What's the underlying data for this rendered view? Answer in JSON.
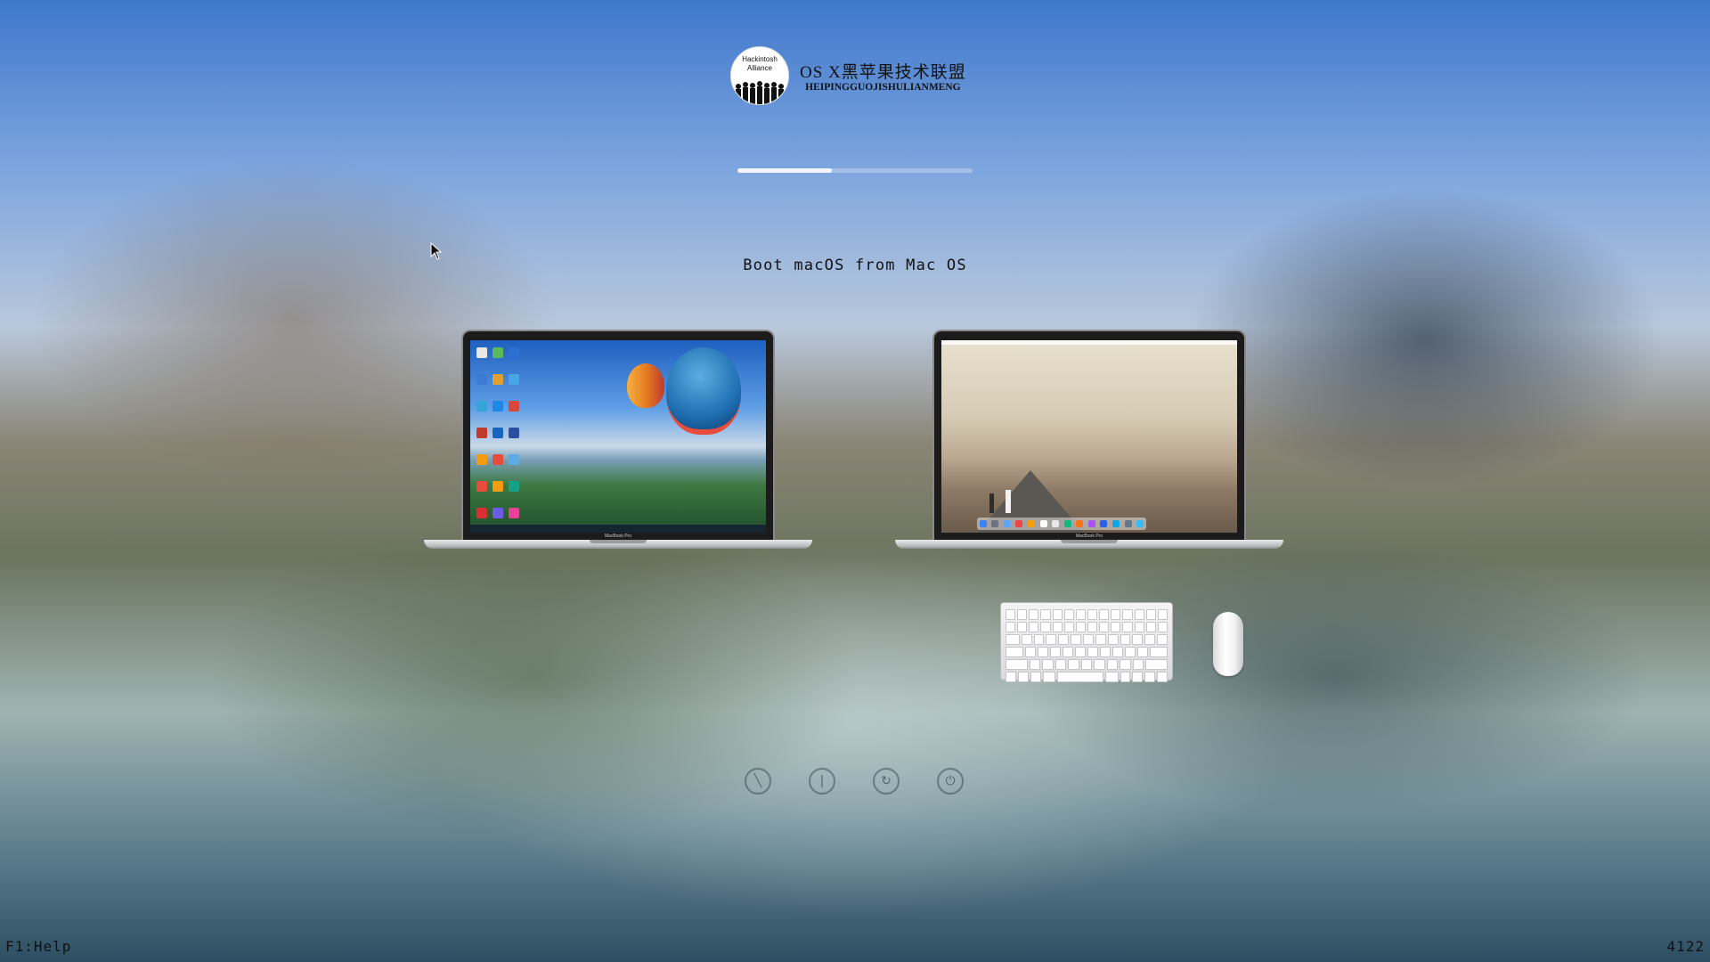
{
  "logo": {
    "badge_text": "Hackintosh Alliance",
    "title": "OS X黑苹果技术联盟",
    "subtitle": "HEIPINGGUOJISHULIANMENG"
  },
  "boot_progress": 0.4,
  "selected_entry_title": "Boot macOS from Mac OS",
  "boot_entries": [
    {
      "name": "windows-volume",
      "icon": "laptop-windows-desktop-icon",
      "laptop_label": "MacBook Pro"
    },
    {
      "name": "macos-volume",
      "icon": "laptop-macos-desktop-icon",
      "laptop_label": "MacBook Pro"
    }
  ],
  "action_buttons": [
    {
      "name": "shell-tool-button",
      "icon": "terminal-icon",
      "glyph": "╲"
    },
    {
      "name": "shutdown-button",
      "icon": "power-icon",
      "glyph": "|"
    },
    {
      "name": "restart-button",
      "icon": "restart-icon",
      "glyph": "↻"
    },
    {
      "name": "power-off-button",
      "icon": "power-off-icon",
      "glyph": "⏻"
    }
  ],
  "footer": {
    "help_hint": "F1:Help",
    "clock": "4122"
  },
  "colors": {
    "text": "#111111",
    "progress_fill": "#f2f6fb",
    "action_ring": "#3c4b55"
  }
}
